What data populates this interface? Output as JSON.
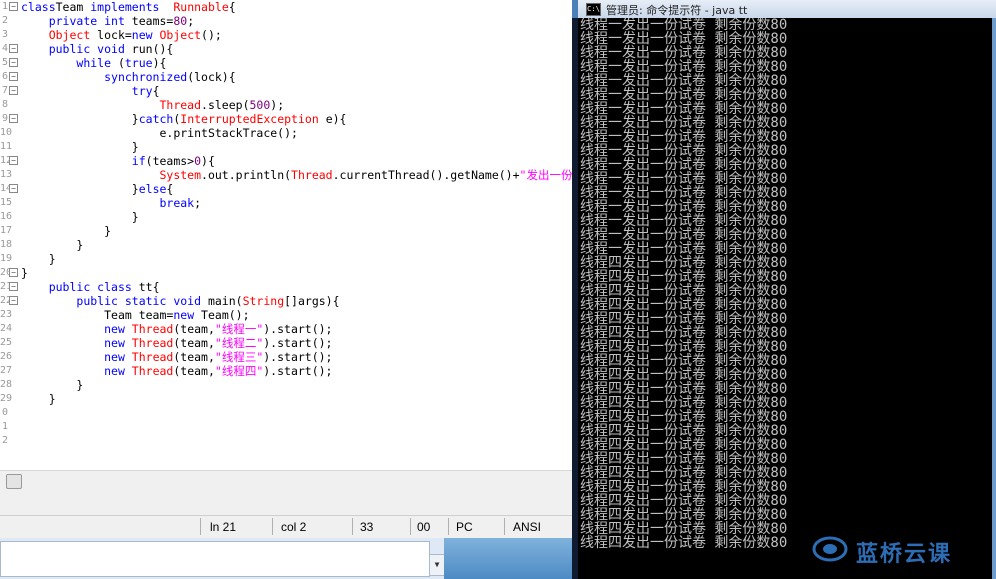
{
  "editor": {
    "lines": [
      {
        "n": "1",
        "fold": "⊟",
        "indent": 0,
        "tokens": [
          [
            "kw",
            "class"
          ],
          [
            "",
            "Team "
          ],
          [
            "kw",
            "implements"
          ],
          [
            "",
            "  "
          ],
          [
            "ty",
            "Runnable"
          ],
          [
            "",
            "{"
          ]
        ]
      },
      {
        "n": "2",
        "fold": "",
        "indent": 1,
        "tokens": [
          [
            "kw",
            "private"
          ],
          [
            "",
            ""
          ],
          [
            "kw",
            " int"
          ],
          [
            "",
            " teams="
          ],
          [
            "num",
            "80"
          ],
          [
            "",
            ";"
          ]
        ]
      },
      {
        "n": "3",
        "fold": "",
        "indent": 1,
        "tokens": [
          [
            "ty",
            "Object"
          ],
          [
            "",
            " lock="
          ],
          [
            "kw",
            "new"
          ],
          [
            "ty",
            " Object"
          ],
          [
            "",
            "();"
          ]
        ]
      },
      {
        "n": "4",
        "fold": "⊟",
        "indent": 1,
        "tokens": [
          [
            "kw",
            "public"
          ],
          [
            "kw",
            " void"
          ],
          [
            "",
            " run(){"
          ]
        ]
      },
      {
        "n": "5",
        "fold": "⊟",
        "indent": 2,
        "tokens": [
          [
            "kw",
            "while"
          ],
          [
            "",
            " ("
          ],
          [
            "kw",
            "true"
          ],
          [
            "",
            ")"
          ],
          [
            "",
            "{"
          ]
        ]
      },
      {
        "n": "6",
        "fold": "⊟",
        "indent": 3,
        "tokens": [
          [
            "kw",
            "synchronized"
          ],
          [
            "",
            "(lock){"
          ]
        ]
      },
      {
        "n": "7",
        "fold": "⊟",
        "indent": 4,
        "tokens": [
          [
            "kw",
            "try"
          ],
          [
            "",
            "{"
          ]
        ]
      },
      {
        "n": "8",
        "fold": "",
        "indent": 5,
        "tokens": [
          [
            "ty",
            "Thread"
          ],
          [
            "",
            ".sleep("
          ],
          [
            "num",
            "500"
          ],
          [
            "",
            ");"
          ]
        ]
      },
      {
        "n": "9",
        "fold": "⊟",
        "indent": 4,
        "tokens": [
          [
            "",
            "}"
          ],
          [
            "kw",
            "catch"
          ],
          [
            "",
            "("
          ],
          [
            "ty",
            "InterruptedException"
          ],
          [
            "",
            " e){"
          ]
        ]
      },
      {
        "n": "10",
        "fold": "",
        "indent": 5,
        "tokens": [
          [
            "",
            "e.printStackTrace();"
          ]
        ]
      },
      {
        "n": "11",
        "fold": "",
        "indent": 4,
        "tokens": [
          [
            "",
            "}"
          ]
        ]
      },
      {
        "n": "12",
        "fold": "⊟",
        "indent": 4,
        "tokens": [
          [
            "kw",
            "if"
          ],
          [
            "",
            "(teams>"
          ],
          [
            "num",
            "0"
          ],
          [
            "",
            "){"
          ]
        ]
      },
      {
        "n": "13",
        "fold": "",
        "indent": 5,
        "tokens": [
          [
            "ty",
            "System"
          ],
          [
            "",
            ".out.println("
          ],
          [
            "ty",
            "Thread"
          ],
          [
            "",
            ".currentThread().getName()+"
          ],
          [
            "str",
            "\"发出一份"
          ]
        ]
      },
      {
        "n": "14",
        "fold": "⊟",
        "indent": 4,
        "tokens": [
          [
            "",
            "}"
          ],
          [
            "kw",
            "else"
          ],
          [
            "",
            "{"
          ]
        ]
      },
      {
        "n": "15",
        "fold": "",
        "indent": 5,
        "tokens": [
          [
            "kw",
            "break"
          ],
          [
            "",
            ";"
          ]
        ]
      },
      {
        "n": "16",
        "fold": "",
        "indent": 4,
        "tokens": [
          [
            "",
            "}"
          ]
        ]
      },
      {
        "n": "17",
        "fold": "",
        "indent": 3,
        "tokens": [
          [
            "",
            "}"
          ]
        ]
      },
      {
        "n": "18",
        "fold": "",
        "indent": 2,
        "tokens": [
          [
            "",
            "}"
          ]
        ]
      },
      {
        "n": "19",
        "fold": "",
        "indent": 1,
        "tokens": [
          [
            "",
            "}"
          ]
        ]
      },
      {
        "n": "20",
        "fold": "⊟",
        "indent": 0,
        "tokens": [
          [
            "",
            "}"
          ]
        ]
      },
      {
        "n": "21",
        "fold": "⊟",
        "indent": 1,
        "tokens": [
          [
            "kw",
            "public"
          ],
          [
            "kw",
            " class"
          ],
          [
            "",
            " tt{"
          ]
        ]
      },
      {
        "n": "22",
        "fold": "⊟",
        "indent": 2,
        "tokens": [
          [
            "kw",
            "public"
          ],
          [
            "kw",
            " static"
          ],
          [
            "kw",
            " void"
          ],
          [
            "",
            " main("
          ],
          [
            "ty",
            "String"
          ],
          [
            "",
            "[]args){"
          ]
        ]
      },
      {
        "n": "23",
        "fold": "",
        "indent": 3,
        "tokens": [
          [
            "",
            "Team team="
          ],
          [
            "kw",
            "new"
          ],
          [
            "",
            " Team();"
          ]
        ]
      },
      {
        "n": "24",
        "fold": "",
        "indent": 3,
        "tokens": [
          [
            "kw",
            "new"
          ],
          [
            "ty",
            " Thread"
          ],
          [
            "",
            "(team,"
          ],
          [
            "str",
            "\"线程一\""
          ],
          [
            "",
            ").start();"
          ]
        ]
      },
      {
        "n": "25",
        "fold": "",
        "indent": 3,
        "tokens": [
          [
            "kw",
            "new"
          ],
          [
            "ty",
            " Thread"
          ],
          [
            "",
            "(team,"
          ],
          [
            "str",
            "\"线程二\""
          ],
          [
            "",
            ").start();"
          ]
        ]
      },
      {
        "n": "26",
        "fold": "",
        "indent": 3,
        "tokens": [
          [
            "kw",
            "new"
          ],
          [
            "ty",
            " Thread"
          ],
          [
            "",
            "(team,"
          ],
          [
            "str",
            "\"线程三\""
          ],
          [
            "",
            ").start();"
          ]
        ]
      },
      {
        "n": "27",
        "fold": "",
        "indent": 3,
        "tokens": [
          [
            "kw",
            "new"
          ],
          [
            "ty",
            " Thread"
          ],
          [
            "",
            "(team,"
          ],
          [
            "str",
            "\"线程四\""
          ],
          [
            "",
            ").start();"
          ]
        ]
      },
      {
        "n": "28",
        "fold": "",
        "indent": 2,
        "tokens": [
          [
            "",
            "}"
          ]
        ]
      },
      {
        "n": "29",
        "fold": "",
        "indent": 1,
        "tokens": [
          [
            "",
            "}"
          ]
        ]
      },
      {
        "n": "0",
        "fold": "",
        "indent": 0,
        "tokens": []
      },
      {
        "n": "1",
        "fold": "",
        "indent": 0,
        "tokens": []
      },
      {
        "n": "2",
        "fold": "",
        "indent": 0,
        "tokens": []
      }
    ]
  },
  "statusbar": {
    "line": "ln 21",
    "col": "col 2",
    "sel": "33",
    "sel2": "00",
    "eol": "PC",
    "encoding": "ANSI"
  },
  "console": {
    "title": "管理员: 命令提示符 - java  tt",
    "icon_text": "C:\\",
    "thread1_text": "线程一发出一份试卷 剩余份数80",
    "thread4_text": "线程四发出一份试卷 剩余份数80",
    "thread1_count": 17,
    "thread4_count": 21
  },
  "logo": {
    "text": "蓝桥云课",
    "icon": "lanqiao-logo-icon"
  },
  "colors": {
    "keyword": "#0000ff",
    "type": "#ff0000",
    "number": "#800080",
    "string": "#ff00ff",
    "console_bg": "#000000",
    "console_fg": "#c0c0c0",
    "logo": "#2d6db5"
  }
}
